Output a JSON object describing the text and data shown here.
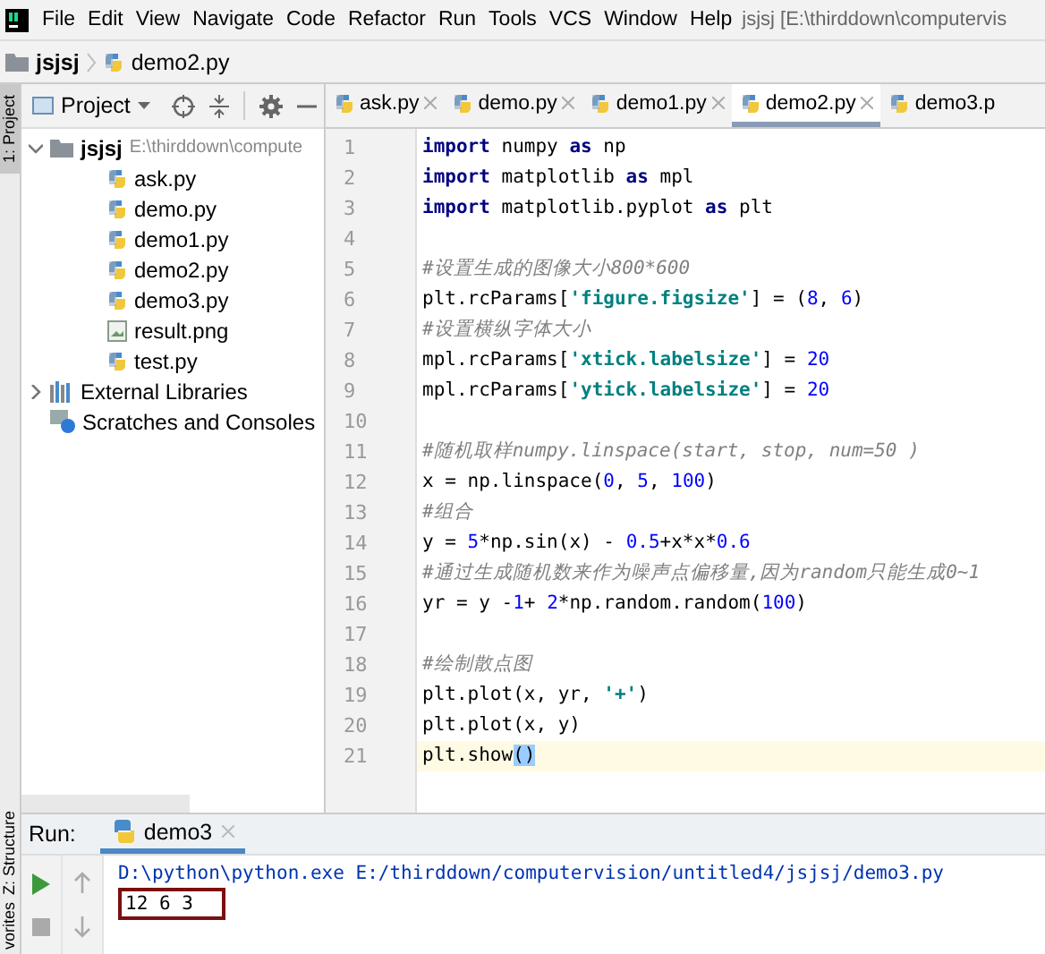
{
  "menu_bar": {
    "items": [
      "File",
      "Edit",
      "View",
      "Navigate",
      "Code",
      "Refactor",
      "Run",
      "Tools",
      "VCS",
      "Window",
      "Help"
    ],
    "title": "jsjsj [E:\\thirddown\\computervis"
  },
  "breadcrumb": {
    "folder": "jsjsj",
    "file": "demo2.py"
  },
  "side_strip": {
    "tabs": [
      {
        "label": "1: Project",
        "selected": true
      },
      {
        "label": "Z: Structure",
        "selected": false
      },
      {
        "label": "vorites",
        "selected": false
      }
    ]
  },
  "project_panel": {
    "title": "Project",
    "tree": [
      {
        "label": "jsjsj",
        "path": "E:\\thirddown\\compute",
        "kind": "folder",
        "expanded": true,
        "children": [
          {
            "label": "ask.py",
            "kind": "python"
          },
          {
            "label": "demo.py",
            "kind": "python"
          },
          {
            "label": "demo1.py",
            "kind": "python"
          },
          {
            "label": "demo2.py",
            "kind": "python"
          },
          {
            "label": "demo3.py",
            "kind": "python"
          },
          {
            "label": "result.png",
            "kind": "image"
          },
          {
            "label": "test.py",
            "kind": "python"
          }
        ]
      },
      {
        "label": "External Libraries",
        "kind": "library",
        "expanded": false
      },
      {
        "label": "Scratches and Consoles",
        "kind": "scratches"
      }
    ]
  },
  "editor": {
    "tabs": [
      {
        "label": "ask.py",
        "selected": false,
        "closable": true
      },
      {
        "label": "demo.py",
        "selected": false,
        "closable": true
      },
      {
        "label": "demo1.py",
        "selected": false,
        "closable": true
      },
      {
        "label": "demo2.py",
        "selected": true,
        "closable": true
      },
      {
        "label": "demo3.p",
        "selected": false,
        "closable": false
      }
    ],
    "lines": [
      {
        "number": "1",
        "current": false,
        "tokens": [
          {
            "kind": "keyword",
            "text": "import"
          },
          {
            "kind": "plain",
            "text": " numpy "
          },
          {
            "kind": "keyword",
            "text": "as"
          },
          {
            "kind": "plain",
            "text": " np"
          }
        ]
      },
      {
        "number": "2",
        "current": false,
        "tokens": [
          {
            "kind": "keyword",
            "text": "import"
          },
          {
            "kind": "plain",
            "text": " matplotlib "
          },
          {
            "kind": "keyword",
            "text": "as"
          },
          {
            "kind": "plain",
            "text": " mpl"
          }
        ]
      },
      {
        "number": "3",
        "current": false,
        "tokens": [
          {
            "kind": "keyword",
            "text": "import"
          },
          {
            "kind": "plain",
            "text": " matplotlib.pyplot "
          },
          {
            "kind": "keyword",
            "text": "as"
          },
          {
            "kind": "plain",
            "text": " plt"
          }
        ]
      },
      {
        "number": "4",
        "current": false
      },
      {
        "number": "5",
        "current": false,
        "tokens": [
          {
            "kind": "comment",
            "text": "#设置生成的图像大小800*600"
          }
        ]
      },
      {
        "number": "6",
        "current": false,
        "tokens": [
          {
            "kind": "plain",
            "text": "plt.rcParams["
          },
          {
            "kind": "string",
            "text": "'figure.figsize'"
          },
          {
            "kind": "plain",
            "text": "] = ("
          },
          {
            "kind": "number",
            "text": "8"
          },
          {
            "kind": "plain",
            "text": ", "
          },
          {
            "kind": "number",
            "text": "6"
          },
          {
            "kind": "plain",
            "text": ")"
          }
        ]
      },
      {
        "number": "7",
        "current": false,
        "tokens": [
          {
            "kind": "comment",
            "text": "#设置横纵字体大小"
          }
        ]
      },
      {
        "number": "8",
        "current": false,
        "tokens": [
          {
            "kind": "plain",
            "text": "mpl.rcParams["
          },
          {
            "kind": "string",
            "text": "'xtick.labelsize'"
          },
          {
            "kind": "plain",
            "text": "] = "
          },
          {
            "kind": "number",
            "text": "20"
          }
        ]
      },
      {
        "number": "9",
        "current": false,
        "tokens": [
          {
            "kind": "plain",
            "text": "mpl.rcParams["
          },
          {
            "kind": "string",
            "text": "'ytick.labelsize'"
          },
          {
            "kind": "plain",
            "text": "] = "
          },
          {
            "kind": "number",
            "text": "20"
          }
        ]
      },
      {
        "number": "10",
        "current": false
      },
      {
        "number": "11",
        "current": false,
        "tokens": [
          {
            "kind": "comment",
            "text": "#随机取样numpy.linspace(start, stop, num=50 )"
          }
        ]
      },
      {
        "number": "12",
        "current": false,
        "tokens": [
          {
            "kind": "plain",
            "text": "x = np.linspace("
          },
          {
            "kind": "number",
            "text": "0"
          },
          {
            "kind": "plain",
            "text": ", "
          },
          {
            "kind": "number",
            "text": "5"
          },
          {
            "kind": "plain",
            "text": ", "
          },
          {
            "kind": "number",
            "text": "100"
          },
          {
            "kind": "plain",
            "text": ")"
          }
        ]
      },
      {
        "number": "13",
        "current": false,
        "tokens": [
          {
            "kind": "comment",
            "text": "#组合"
          }
        ]
      },
      {
        "number": "14",
        "current": false,
        "tokens": [
          {
            "kind": "plain",
            "text": "y = "
          },
          {
            "kind": "number",
            "text": "5"
          },
          {
            "kind": "plain",
            "text": "*np.sin(x) - "
          },
          {
            "kind": "number",
            "text": "0.5"
          },
          {
            "kind": "plain",
            "text": "+x*x*"
          },
          {
            "kind": "number",
            "text": "0.6"
          }
        ]
      },
      {
        "number": "15",
        "current": false,
        "tokens": [
          {
            "kind": "comment",
            "text": "#通过生成随机数来作为噪声点偏移量,因为random只能生成0~1"
          }
        ]
      },
      {
        "number": "16",
        "current": false,
        "tokens": [
          {
            "kind": "plain",
            "text": "yr = y -"
          },
          {
            "kind": "number",
            "text": "1"
          },
          {
            "kind": "plain",
            "text": "+ "
          },
          {
            "kind": "number",
            "text": "2"
          },
          {
            "kind": "plain",
            "text": "*np.random.random("
          },
          {
            "kind": "number",
            "text": "100"
          },
          {
            "kind": "plain",
            "text": ")"
          }
        ]
      },
      {
        "number": "17",
        "current": false
      },
      {
        "number": "18",
        "current": false,
        "tokens": [
          {
            "kind": "comment",
            "text": "#绘制散点图"
          }
        ]
      },
      {
        "number": "19",
        "current": false,
        "tokens": [
          {
            "kind": "plain",
            "text": "plt.plot(x, yr, "
          },
          {
            "kind": "string",
            "text": "'+'"
          },
          {
            "kind": "plain",
            "text": ")"
          }
        ]
      },
      {
        "number": "20",
        "current": false,
        "tokens": [
          {
            "kind": "plain",
            "text": "plt.plot(x, y)"
          }
        ]
      },
      {
        "number": "21",
        "current": true,
        "tokens": [
          {
            "kind": "plain",
            "text": "plt.show"
          },
          {
            "kind": "match",
            "text": "()"
          }
        ]
      }
    ]
  },
  "run_panel": {
    "label": "Run:",
    "tab": "demo3",
    "command": "D:\\python\\python.exe E:/thirddown/computervision/untitled4/jsjsj/demo3.py",
    "output": "12 6 3"
  }
}
